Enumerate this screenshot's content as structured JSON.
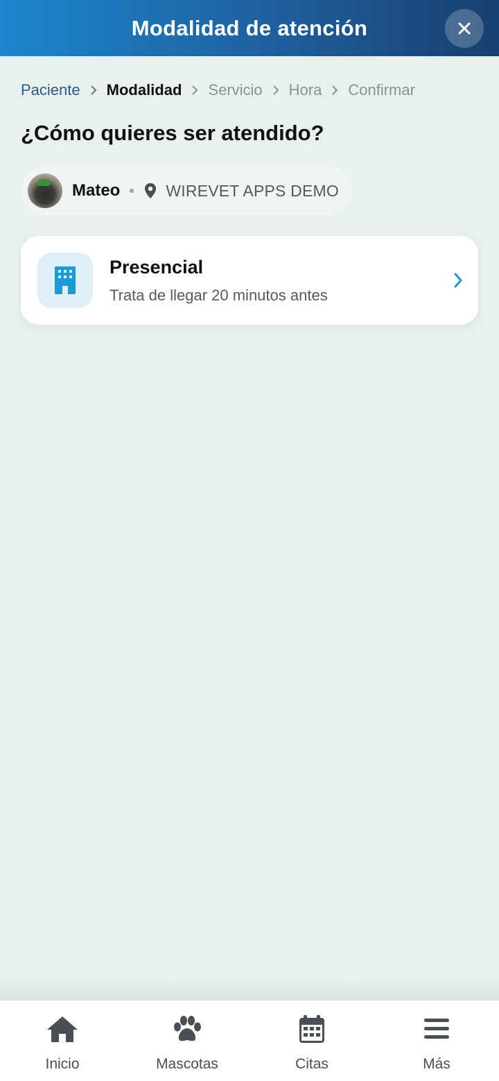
{
  "header": {
    "title": "Modalidad de atención",
    "close_icon": "close-icon"
  },
  "breadcrumb": {
    "steps": [
      {
        "label": "Paciente",
        "state": "done"
      },
      {
        "label": "Modalidad",
        "state": "active"
      },
      {
        "label": "Servicio",
        "state": "pending"
      },
      {
        "label": "Hora",
        "state": "pending"
      },
      {
        "label": "Confirmar",
        "state": "pending"
      }
    ]
  },
  "question": "¿Cómo quieres ser atendido?",
  "patient": {
    "name": "Mateo",
    "location_icon": "map-pin-icon",
    "clinic": "WIREVET APPS DEMO"
  },
  "options": [
    {
      "title": "Presencial",
      "subtitle": "Trata de llegar 20 minutos antes",
      "icon": "building-icon"
    }
  ],
  "nav": {
    "items": [
      {
        "label": "Inicio",
        "icon": "home-icon"
      },
      {
        "label": "Mascotas",
        "icon": "paw-icon"
      },
      {
        "label": "Citas",
        "icon": "calendar-icon"
      },
      {
        "label": "Más",
        "icon": "menu-icon"
      }
    ]
  },
  "colors": {
    "header_start": "#1b86cc",
    "header_end": "#173f6f",
    "background": "#e8f1ee",
    "accent": "#1a9ad6",
    "breadcrumb_done": "#2e5a87",
    "nav_icon": "#4a4f55"
  }
}
